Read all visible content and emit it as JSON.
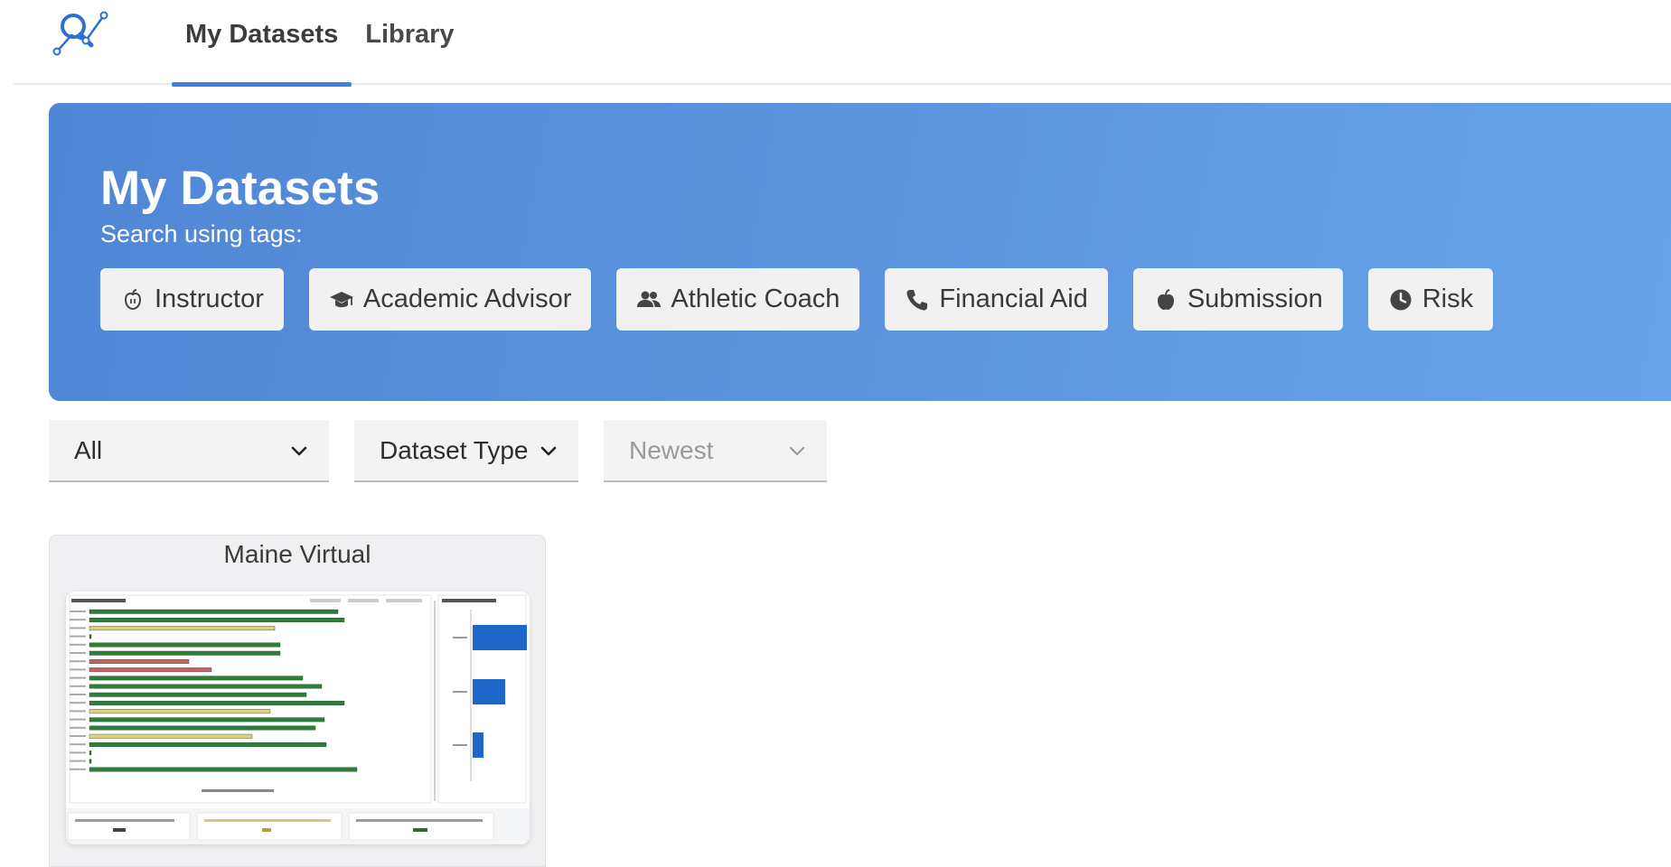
{
  "nav": {
    "tabs": [
      {
        "label": "My Datasets",
        "active": true
      },
      {
        "label": "Library",
        "active": false
      }
    ]
  },
  "hero": {
    "title": "My Datasets",
    "subtitle": "Search using tags:",
    "tags": [
      {
        "label": "Instructor",
        "icon": "apple-outline-icon"
      },
      {
        "label": "Academic Advisor",
        "icon": "graduation-cap-icon"
      },
      {
        "label": "Athletic Coach",
        "icon": "users-icon"
      },
      {
        "label": "Financial Aid",
        "icon": "phone-icon"
      },
      {
        "label": "Submission",
        "icon": "apple-icon"
      },
      {
        "label": "Risk",
        "icon": "clock-icon"
      }
    ]
  },
  "filters": {
    "scope": {
      "value": "All"
    },
    "type": {
      "value": "Dataset Type"
    },
    "sort": {
      "value": "Newest",
      "disabled": true
    }
  },
  "datasets": [
    {
      "title": "Maine Virtual"
    }
  ],
  "colors": {
    "accent": "#3b82e0",
    "hero_start": "#4f86d6",
    "hero_end": "#67a4ea",
    "tag_bg": "#f1f1f2"
  }
}
